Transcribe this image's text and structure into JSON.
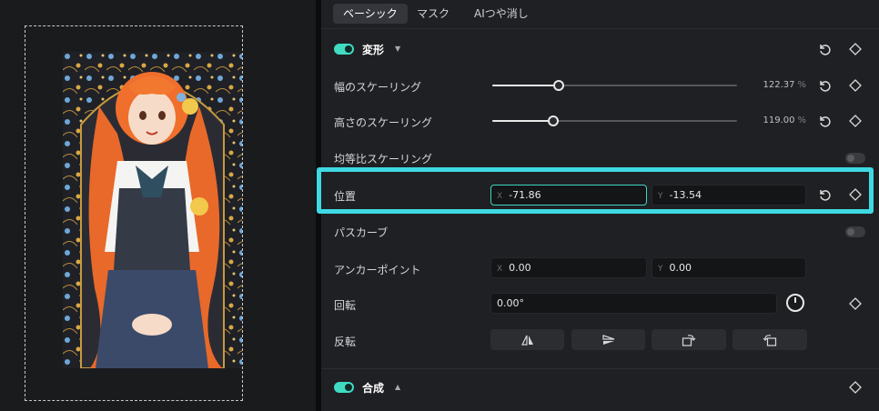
{
  "tabs": [
    "ベーシック",
    "マスク",
    "AIつや消し"
  ],
  "transform": {
    "title": "変形",
    "enabled": true,
    "width_scale": {
      "label": "幅のスケーリング",
      "value": "122.37",
      "unit": "%",
      "level": 0.27
    },
    "height_scale": {
      "label": "高さのスケーリング",
      "value": "119.00",
      "unit": "%",
      "level": 0.25
    },
    "uniform_scale": {
      "label": "均等比スケーリング",
      "enabled": false
    },
    "position": {
      "label": "位置",
      "x_axis": "X",
      "x": "-71.86",
      "y_axis": "Y",
      "y": "-13.54"
    },
    "path_curve": {
      "label": "パスカーブ",
      "enabled": false
    },
    "anchor": {
      "label": "アンカーポイント",
      "x_axis": "X",
      "x": "0.00",
      "y_axis": "Y",
      "y": "0.00"
    },
    "rotation": {
      "label": "回転",
      "value": "0.00°"
    },
    "flip": {
      "label": "反転"
    }
  },
  "composite": {
    "title": "合成",
    "enabled": true
  },
  "colors": {
    "accent": "#40dcc2",
    "highlight": "#3fd9e3"
  },
  "icons": [
    "reset-icon",
    "keyframe-diamond-icon",
    "flip-horizontal-icon",
    "flip-vertical-icon",
    "rotate-right-icon",
    "rotate-left-icon",
    "caret-down-icon",
    "caret-up-icon"
  ]
}
